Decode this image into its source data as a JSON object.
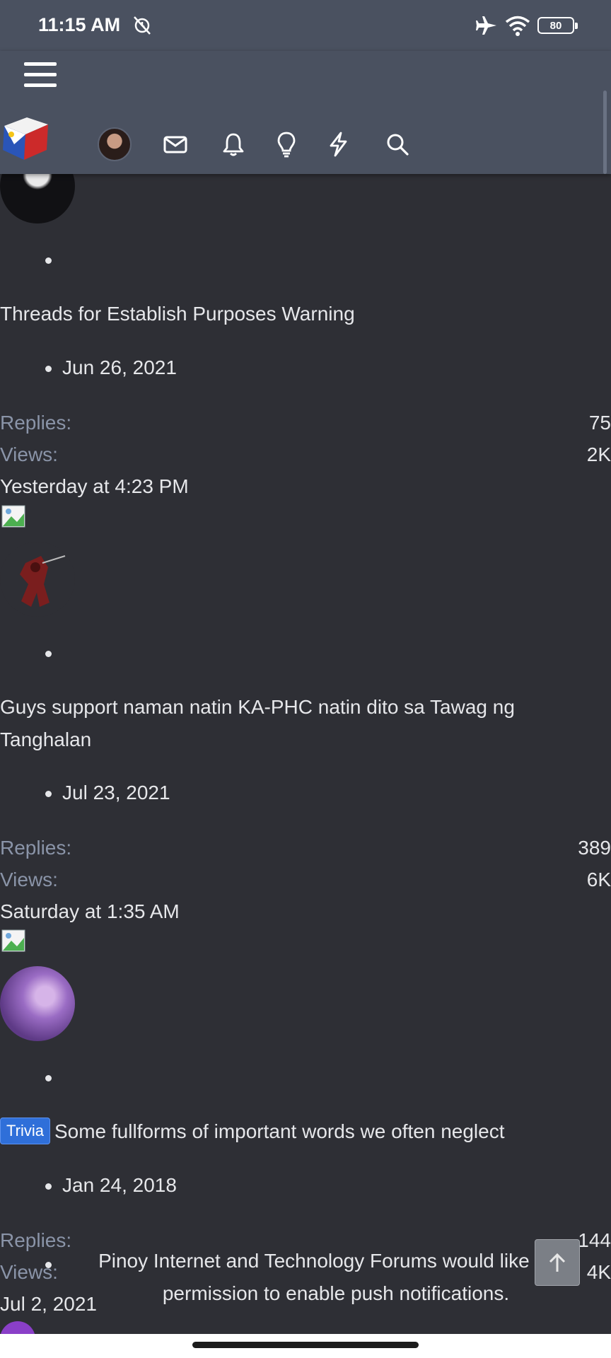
{
  "status_bar": {
    "time": "11:15 AM",
    "battery": "80",
    "icons": [
      "alarm-off-icon",
      "airplane-icon",
      "wifi-icon",
      "battery-icon"
    ]
  },
  "header": {
    "nav_icons": [
      "hamburger-icon",
      "site-logo",
      "user-avatar",
      "mail-icon",
      "bell-icon",
      "lightbulb-icon",
      "bolt-icon",
      "search-icon"
    ]
  },
  "threads": [
    {
      "title": "Threads for Establish Purposes Warning",
      "date": "Jun 26, 2021",
      "replies_label": "Replies:",
      "replies": "75",
      "views_label": "Views:",
      "views": "2K",
      "last_post": "Yesterday at 4:23 PM"
    },
    {
      "title": "Guys support naman natin KA-PHC natin dito sa Tawag ng Tanghalan",
      "date": "Jul 23, 2021",
      "replies_label": "Replies:",
      "replies": "389",
      "views_label": "Views:",
      "views": "6K",
      "last_post": "Saturday at 1:35 AM"
    },
    {
      "prefix": "Trivia",
      "title": "Some fullforms of important words we often neglect",
      "date": "Jan 24, 2018",
      "replies_label": "Replies:",
      "replies": "144",
      "views_label": "Views:",
      "views": "4K",
      "last_post": "Jul 2, 2021"
    }
  ],
  "push_prompt": {
    "text": "Pinoy Internet and Technology Forums would like your permission to enable push notifications."
  },
  "colors": {
    "background": "#2e2f35",
    "header": "#4a5160",
    "muted_label": "#8a94a8",
    "prefix": "#2f6fd9"
  }
}
